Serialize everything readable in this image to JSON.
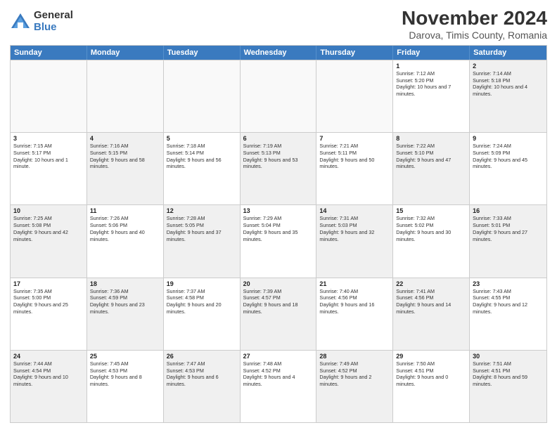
{
  "logo": {
    "general": "General",
    "blue": "Blue"
  },
  "title": "November 2024",
  "subtitle": "Darova, Timis County, Romania",
  "header_days": [
    "Sunday",
    "Monday",
    "Tuesday",
    "Wednesday",
    "Thursday",
    "Friday",
    "Saturday"
  ],
  "rows": [
    [
      {
        "day": "",
        "info": "",
        "shaded": false,
        "empty": true
      },
      {
        "day": "",
        "info": "",
        "shaded": false,
        "empty": true
      },
      {
        "day": "",
        "info": "",
        "shaded": false,
        "empty": true
      },
      {
        "day": "",
        "info": "",
        "shaded": false,
        "empty": true
      },
      {
        "day": "",
        "info": "",
        "shaded": false,
        "empty": true
      },
      {
        "day": "1",
        "info": "Sunrise: 7:12 AM\nSunset: 5:20 PM\nDaylight: 10 hours and 7 minutes.",
        "shaded": false,
        "empty": false
      },
      {
        "day": "2",
        "info": "Sunrise: 7:14 AM\nSunset: 5:18 PM\nDaylight: 10 hours and 4 minutes.",
        "shaded": true,
        "empty": false
      }
    ],
    [
      {
        "day": "3",
        "info": "Sunrise: 7:15 AM\nSunset: 5:17 PM\nDaylight: 10 hours and 1 minute.",
        "shaded": false,
        "empty": false
      },
      {
        "day": "4",
        "info": "Sunrise: 7:16 AM\nSunset: 5:15 PM\nDaylight: 9 hours and 58 minutes.",
        "shaded": true,
        "empty": false
      },
      {
        "day": "5",
        "info": "Sunrise: 7:18 AM\nSunset: 5:14 PM\nDaylight: 9 hours and 56 minutes.",
        "shaded": false,
        "empty": false
      },
      {
        "day": "6",
        "info": "Sunrise: 7:19 AM\nSunset: 5:13 PM\nDaylight: 9 hours and 53 minutes.",
        "shaded": true,
        "empty": false
      },
      {
        "day": "7",
        "info": "Sunrise: 7:21 AM\nSunset: 5:11 PM\nDaylight: 9 hours and 50 minutes.",
        "shaded": false,
        "empty": false
      },
      {
        "day": "8",
        "info": "Sunrise: 7:22 AM\nSunset: 5:10 PM\nDaylight: 9 hours and 47 minutes.",
        "shaded": true,
        "empty": false
      },
      {
        "day": "9",
        "info": "Sunrise: 7:24 AM\nSunset: 5:09 PM\nDaylight: 9 hours and 45 minutes.",
        "shaded": false,
        "empty": false
      }
    ],
    [
      {
        "day": "10",
        "info": "Sunrise: 7:25 AM\nSunset: 5:08 PM\nDaylight: 9 hours and 42 minutes.",
        "shaded": true,
        "empty": false
      },
      {
        "day": "11",
        "info": "Sunrise: 7:26 AM\nSunset: 5:06 PM\nDaylight: 9 hours and 40 minutes.",
        "shaded": false,
        "empty": false
      },
      {
        "day": "12",
        "info": "Sunrise: 7:28 AM\nSunset: 5:05 PM\nDaylight: 9 hours and 37 minutes.",
        "shaded": true,
        "empty": false
      },
      {
        "day": "13",
        "info": "Sunrise: 7:29 AM\nSunset: 5:04 PM\nDaylight: 9 hours and 35 minutes.",
        "shaded": false,
        "empty": false
      },
      {
        "day": "14",
        "info": "Sunrise: 7:31 AM\nSunset: 5:03 PM\nDaylight: 9 hours and 32 minutes.",
        "shaded": true,
        "empty": false
      },
      {
        "day": "15",
        "info": "Sunrise: 7:32 AM\nSunset: 5:02 PM\nDaylight: 9 hours and 30 minutes.",
        "shaded": false,
        "empty": false
      },
      {
        "day": "16",
        "info": "Sunrise: 7:33 AM\nSunset: 5:01 PM\nDaylight: 9 hours and 27 minutes.",
        "shaded": true,
        "empty": false
      }
    ],
    [
      {
        "day": "17",
        "info": "Sunrise: 7:35 AM\nSunset: 5:00 PM\nDaylight: 9 hours and 25 minutes.",
        "shaded": false,
        "empty": false
      },
      {
        "day": "18",
        "info": "Sunrise: 7:36 AM\nSunset: 4:59 PM\nDaylight: 9 hours and 23 minutes.",
        "shaded": true,
        "empty": false
      },
      {
        "day": "19",
        "info": "Sunrise: 7:37 AM\nSunset: 4:58 PM\nDaylight: 9 hours and 20 minutes.",
        "shaded": false,
        "empty": false
      },
      {
        "day": "20",
        "info": "Sunrise: 7:39 AM\nSunset: 4:57 PM\nDaylight: 9 hours and 18 minutes.",
        "shaded": true,
        "empty": false
      },
      {
        "day": "21",
        "info": "Sunrise: 7:40 AM\nSunset: 4:56 PM\nDaylight: 9 hours and 16 minutes.",
        "shaded": false,
        "empty": false
      },
      {
        "day": "22",
        "info": "Sunrise: 7:41 AM\nSunset: 4:56 PM\nDaylight: 9 hours and 14 minutes.",
        "shaded": true,
        "empty": false
      },
      {
        "day": "23",
        "info": "Sunrise: 7:43 AM\nSunset: 4:55 PM\nDaylight: 9 hours and 12 minutes.",
        "shaded": false,
        "empty": false
      }
    ],
    [
      {
        "day": "24",
        "info": "Sunrise: 7:44 AM\nSunset: 4:54 PM\nDaylight: 9 hours and 10 minutes.",
        "shaded": true,
        "empty": false
      },
      {
        "day": "25",
        "info": "Sunrise: 7:45 AM\nSunset: 4:53 PM\nDaylight: 9 hours and 8 minutes.",
        "shaded": false,
        "empty": false
      },
      {
        "day": "26",
        "info": "Sunrise: 7:47 AM\nSunset: 4:53 PM\nDaylight: 9 hours and 6 minutes.",
        "shaded": true,
        "empty": false
      },
      {
        "day": "27",
        "info": "Sunrise: 7:48 AM\nSunset: 4:52 PM\nDaylight: 9 hours and 4 minutes.",
        "shaded": false,
        "empty": false
      },
      {
        "day": "28",
        "info": "Sunrise: 7:49 AM\nSunset: 4:52 PM\nDaylight: 9 hours and 2 minutes.",
        "shaded": true,
        "empty": false
      },
      {
        "day": "29",
        "info": "Sunrise: 7:50 AM\nSunset: 4:51 PM\nDaylight: 9 hours and 0 minutes.",
        "shaded": false,
        "empty": false
      },
      {
        "day": "30",
        "info": "Sunrise: 7:51 AM\nSunset: 4:51 PM\nDaylight: 8 hours and 59 minutes.",
        "shaded": true,
        "empty": false
      }
    ]
  ]
}
